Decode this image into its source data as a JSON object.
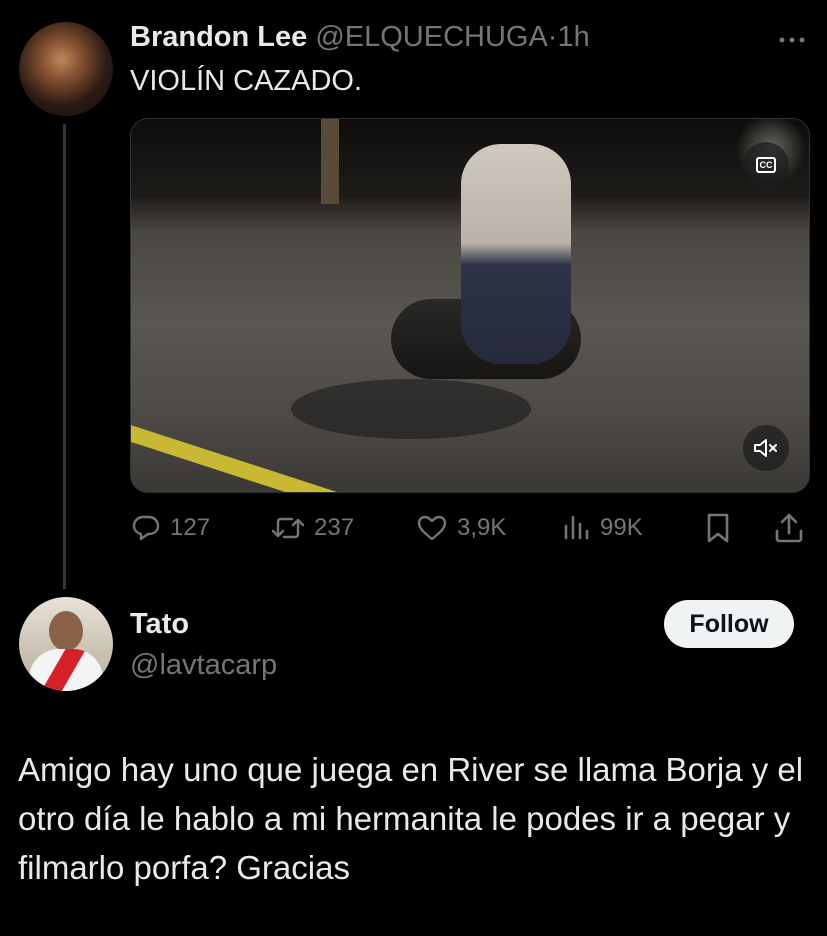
{
  "tweet": {
    "author_name": "Brandon Lee",
    "author_handle": "@ELQUECHUGA",
    "separator": "·",
    "time": "1h",
    "text": "VIOLÍN CAZADO.",
    "more_icon": "more-horizontal-icon",
    "media": {
      "type": "video",
      "cc_label": "CC",
      "cc_icon": "closed-captions-icon",
      "mute_icon": "volume-muted-icon"
    },
    "actions": {
      "replies": "127",
      "retweets": "237",
      "likes": "3,9K",
      "views": "99K",
      "reply_icon": "reply-icon",
      "retweet_icon": "retweet-icon",
      "like_icon": "heart-icon",
      "views_icon": "analytics-icon",
      "bookmark_icon": "bookmark-icon",
      "share_icon": "share-icon"
    }
  },
  "reply": {
    "author_name": "Tato",
    "author_handle": "@lavtacarp",
    "follow_label": "Follow",
    "text": "Amigo hay uno que juega en River se llama Borja y el otro día le hablo a mi hermanita le podes ir a pegar y filmarlo porfa? Gracias"
  },
  "colors": {
    "background": "#000000",
    "text_primary": "#e7e9ea",
    "text_secondary": "#71767b",
    "follow_bg": "#eff3f4",
    "thread_line": "#333639"
  }
}
